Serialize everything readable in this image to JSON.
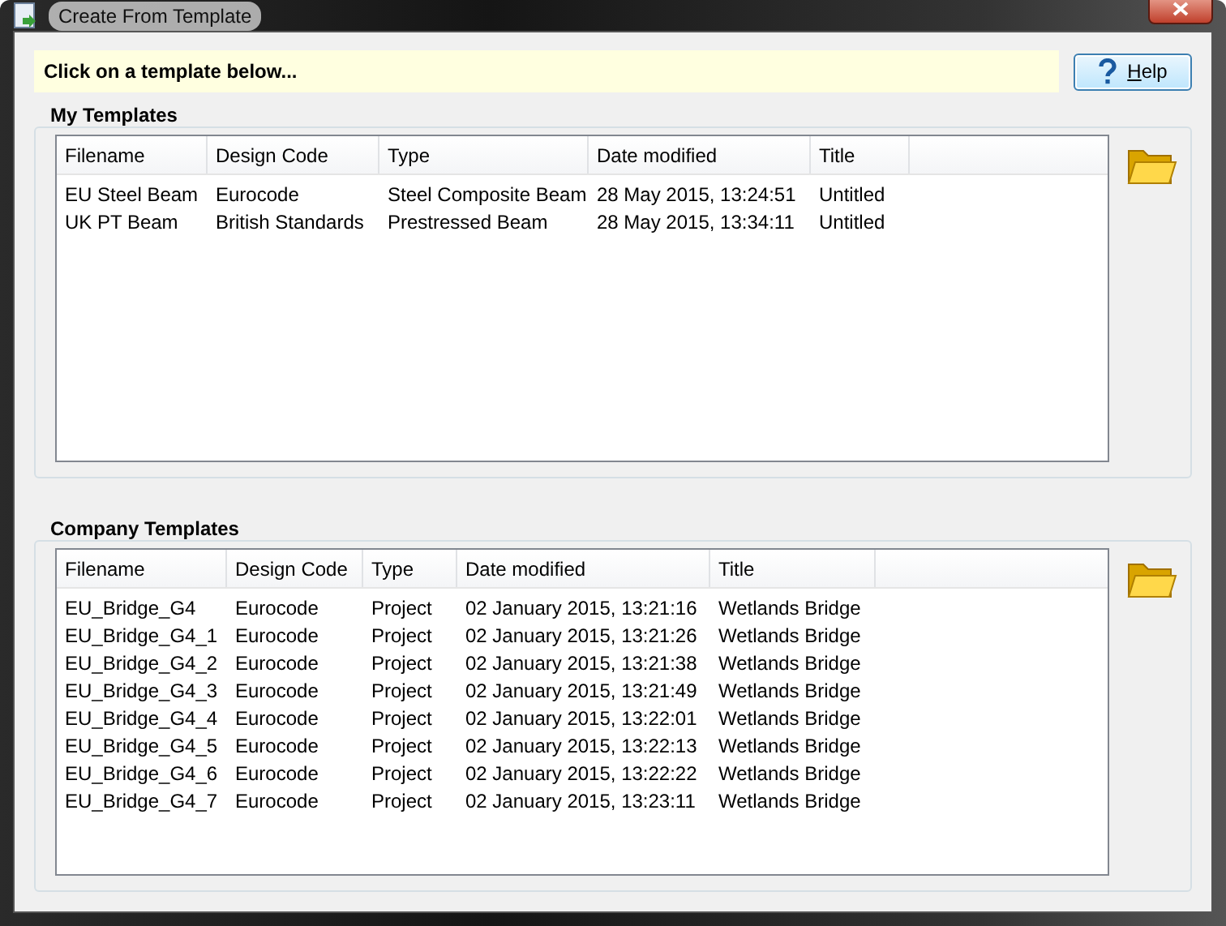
{
  "window": {
    "title": "Create From Template"
  },
  "instruction": "Click on a template below...",
  "help_button": {
    "label": "Help"
  },
  "groups": [
    {
      "title": "My Templates",
      "columns": [
        "Filename",
        "Design Code",
        "Type",
        "Date modified",
        "Title"
      ],
      "rows": [
        [
          "EU Steel Beam",
          "Eurocode",
          "Steel Composite Beam",
          "28 May 2015, 13:24:51",
          "Untitled"
        ],
        [
          "UK PT Beam",
          "British Standards",
          "Prestressed Beam",
          "28 May 2015, 13:34:11",
          "Untitled"
        ]
      ]
    },
    {
      "title": "Company Templates",
      "columns": [
        "Filename",
        "Design Code",
        "Type",
        "Date modified",
        "Title"
      ],
      "rows": [
        [
          "EU_Bridge_G4",
          "Eurocode",
          "Project",
          "02 January 2015, 13:21:16",
          "Wetlands Bridge"
        ],
        [
          "EU_Bridge_G4_1",
          "Eurocode",
          "Project",
          "02 January 2015, 13:21:26",
          "Wetlands Bridge"
        ],
        [
          "EU_Bridge_G4_2",
          "Eurocode",
          "Project",
          "02 January 2015, 13:21:38",
          "Wetlands Bridge"
        ],
        [
          "EU_Bridge_G4_3",
          "Eurocode",
          "Project",
          "02 January 2015, 13:21:49",
          "Wetlands Bridge"
        ],
        [
          "EU_Bridge_G4_4",
          "Eurocode",
          "Project",
          "02 January 2015, 13:22:01",
          "Wetlands Bridge"
        ],
        [
          "EU_Bridge_G4_5",
          "Eurocode",
          "Project",
          "02 January 2015, 13:22:13",
          "Wetlands Bridge"
        ],
        [
          "EU_Bridge_G4_6",
          "Eurocode",
          "Project",
          "02 January 2015, 13:22:22",
          "Wetlands Bridge"
        ],
        [
          "EU_Bridge_G4_7",
          "Eurocode",
          "Project",
          "02 January 2015, 13:23:11",
          "Wetlands Bridge"
        ]
      ]
    }
  ]
}
